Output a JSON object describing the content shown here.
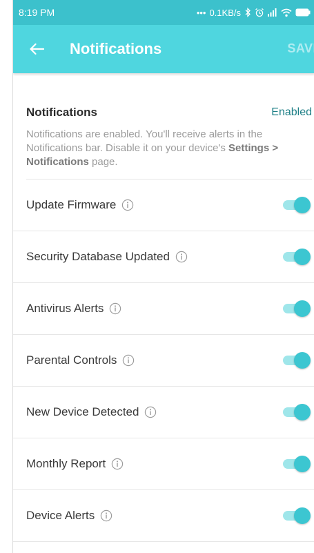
{
  "status_bar": {
    "time": "8:19 PM",
    "network_speed": "0.1KB/s",
    "icons": [
      "dots-icon",
      "bluetooth-icon",
      "alarm-icon",
      "signal-icon",
      "wifi-icon",
      "battery-icon"
    ]
  },
  "app_bar": {
    "back_icon": "arrow-left-icon",
    "title": "Notifications",
    "save_label": "SAVE"
  },
  "notifications": {
    "title": "Notifications",
    "status": "Enabled",
    "description_part1": "Notifications are enabled. You'll receive alerts in the Notifications bar. Disable it on your device's",
    "description_bold1": "Settings > Notifications",
    "description_part2": "page."
  },
  "settings": [
    {
      "label": "Update Firmware",
      "enabled": true
    },
    {
      "label": "Security Database Updated",
      "enabled": true
    },
    {
      "label": "Antivirus Alerts",
      "enabled": true
    },
    {
      "label": "Parental Controls",
      "enabled": true
    },
    {
      "label": "New Device Detected",
      "enabled": true
    },
    {
      "label": "Monthly Report",
      "enabled": true
    },
    {
      "label": "Device Alerts",
      "enabled": true
    }
  ],
  "colors": {
    "status_bar": "#3cc1cc",
    "app_bar": "#4fd6df",
    "toggle_on": "#3cc6d1",
    "enabled_text": "#1d7f86"
  }
}
